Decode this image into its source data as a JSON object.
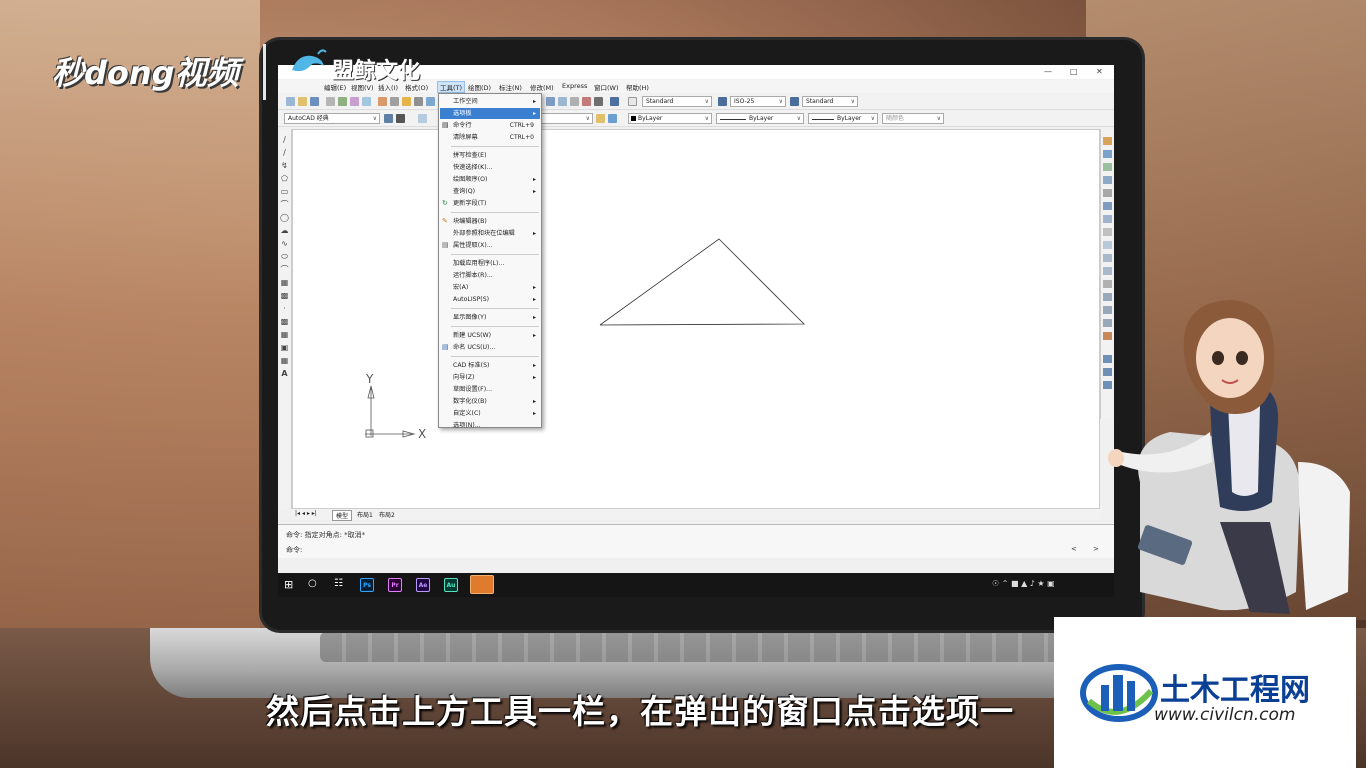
{
  "branding": {
    "left_logo": "秒dong视频",
    "mid_logo": "盟鲸文化"
  },
  "subtitle": "然后点击上方工具一栏，在弹出的窗口点击选项一",
  "watermark": {
    "title": "土木工程网",
    "url": "www.civilcn.com"
  },
  "autocad": {
    "menubar": {
      "items": [
        "编辑(E)",
        "视图(V)",
        "插入(I)",
        "格式(O)",
        "工具(T)",
        "绘图(D)",
        "标注(N)",
        "修改(M)",
        "Express",
        "窗口(W)",
        "帮助(H)"
      ]
    },
    "toolbar": {
      "text_style": "Standard",
      "dim_style": "ISO-25",
      "table_style": "Standard",
      "workspace": "AutoCAD 经典",
      "layer_color": "ByLayer",
      "layer_linetype": "ByLayer",
      "layer_lineweight": "ByLayer",
      "plot_style": "随颜色"
    },
    "tools_menu": {
      "items": [
        {
          "label": "工作空间",
          "arrow": "▸"
        },
        {
          "label": "选项板",
          "arrow": "▸"
        },
        {
          "label": "命令行",
          "shortcut": "CTRL+9"
        },
        {
          "label": "清除屏幕",
          "shortcut": "CTRL+0"
        },
        {
          "label": "拼写检查(E)"
        },
        {
          "label": "快速选择(K)..."
        },
        {
          "label": "绘图顺序(O)",
          "arrow": "▸"
        },
        {
          "label": "查询(Q)",
          "arrow": "▸"
        },
        {
          "label": "更新字段(T)"
        },
        {
          "label": "块编辑器(B)"
        },
        {
          "label": "外部参照和块在位编辑",
          "arrow": "▸"
        },
        {
          "label": "属性提取(X)..."
        },
        {
          "label": "加载应用程序(L)..."
        },
        {
          "label": "运行脚本(R)..."
        },
        {
          "label": "宏(A)",
          "arrow": "▸"
        },
        {
          "label": "AutoLISP(S)",
          "arrow": "▸"
        },
        {
          "label": "显示图像(Y)",
          "arrow": "▸"
        },
        {
          "label": "新建 UCS(W)",
          "arrow": "▸"
        },
        {
          "label": "命名 UCS(U)..."
        },
        {
          "label": "CAD 标准(S)",
          "arrow": "▸"
        },
        {
          "label": "向导(Z)",
          "arrow": "▸"
        },
        {
          "label": "草图设置(F)..."
        },
        {
          "label": "数字化仪(B)",
          "arrow": "▸"
        },
        {
          "label": "自定义(C)",
          "arrow": "▸"
        },
        {
          "label": "选项(N)..."
        }
      ]
    },
    "ucs": {
      "y_label": "Y",
      "x_label": "X"
    },
    "layout_tabs": [
      "模型",
      "布局1",
      "布局2"
    ],
    "command": {
      "history": "命令: 指定对角点: *取消*",
      "prompt": "命令:"
    },
    "taskbar_apps": [
      "Ps",
      "Pr",
      "Ae",
      "Au"
    ]
  }
}
